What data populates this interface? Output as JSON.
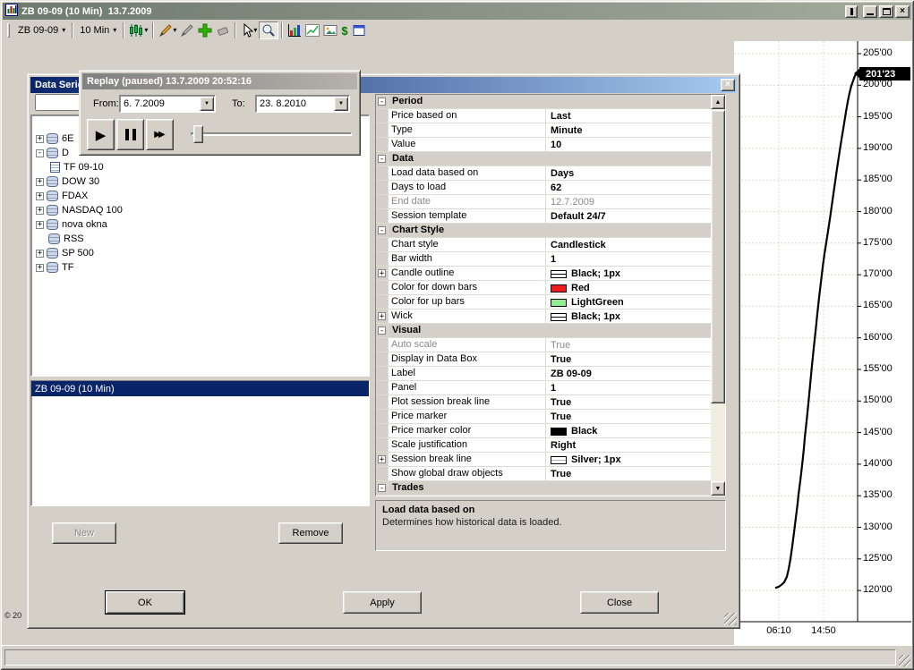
{
  "window": {
    "title": "ZB 09-09 (10 Min)  13.7.2009",
    "copyright": "© 20"
  },
  "toolbar": {
    "instrument": "ZB 09-09",
    "interval": "10 Min"
  },
  "chart": {
    "price_marker": "201'23",
    "price_marker_value": 201.72,
    "y_axis_labels": [
      "205'00",
      "200'00",
      "195'00",
      "190'00",
      "185'00",
      "180'00",
      "175'00",
      "170'00",
      "165'00",
      "160'00",
      "155'00",
      "150'00",
      "145'00",
      "140'00",
      "135'00",
      "130'00",
      "125'00",
      "120'00"
    ],
    "x_axis_labels": [
      "06:10",
      "14:50"
    ],
    "curve": [
      [
        864,
        120.4
      ],
      [
        868,
        120.6
      ],
      [
        871,
        120.9
      ],
      [
        874,
        121.3
      ],
      [
        877,
        122.2
      ],
      [
        879,
        123.4
      ],
      [
        881,
        125.0
      ],
      [
        883,
        127.0
      ],
      [
        885,
        129.2
      ],
      [
        887,
        131.5
      ],
      [
        889,
        133.8
      ],
      [
        890,
        135.2
      ],
      [
        892,
        137.4
      ],
      [
        894,
        139.8
      ],
      [
        896,
        142.5
      ],
      [
        897,
        144.2
      ],
      [
        899,
        146.8
      ],
      [
        901,
        149.6
      ],
      [
        903,
        152.6
      ],
      [
        905,
        155.6
      ],
      [
        907,
        158.4
      ],
      [
        909,
        161.0
      ],
      [
        911,
        163.8
      ],
      [
        913,
        166.4
      ],
      [
        915,
        168.8
      ],
      [
        917,
        171.2
      ],
      [
        919,
        173.3
      ],
      [
        922,
        176.0
      ],
      [
        925,
        178.8
      ],
      [
        928,
        181.8
      ],
      [
        931,
        184.8
      ],
      [
        933,
        186.8
      ],
      [
        936,
        189.6
      ],
      [
        938,
        191.4
      ],
      [
        941,
        194.0
      ],
      [
        943,
        195.8
      ],
      [
        945,
        197.4
      ],
      [
        947,
        198.8
      ],
      [
        949,
        199.9
      ],
      [
        951,
        200.7
      ],
      [
        952,
        201.1
      ],
      [
        953,
        201.5
      ],
      [
        954,
        201.72
      ]
    ]
  },
  "replay": {
    "title": "Replay (paused) 13.7.2009 20:52:16",
    "from_label": "From:",
    "from_value": "6. 7.2009",
    "to_label": "To:",
    "to_value": "23. 8.2010"
  },
  "dialog": {
    "title": "Data Series",
    "selected_series": "ZB 09-09 (10 Min)",
    "tree": [
      {
        "expand": "+",
        "icon": "database-icon",
        "label": "6E"
      },
      {
        "expand": "-",
        "icon": "database-icon",
        "label": "D"
      },
      {
        "child": true,
        "icon": "series-icon",
        "label": "TF 09-10"
      },
      {
        "expand": "+",
        "icon": "database-icon",
        "label": "DOW 30"
      },
      {
        "expand": "+",
        "icon": "database-icon",
        "label": "FDAX"
      },
      {
        "expand": "+",
        "icon": "database-icon",
        "label": "NASDAQ 100"
      },
      {
        "expand": "+",
        "icon": "database-icon",
        "label": "nova okna"
      },
      {
        "icon": "database-icon",
        "label": "RSS"
      },
      {
        "expand": "+",
        "icon": "database-icon",
        "label": "SP 500"
      },
      {
        "expand": "+",
        "icon": "database-icon",
        "label": "TF"
      }
    ],
    "properties": [
      {
        "type": "section",
        "label": "Period"
      },
      {
        "type": "row",
        "label": "Price based on",
        "value": "Last"
      },
      {
        "type": "row",
        "label": "Type",
        "value": "Minute"
      },
      {
        "type": "row",
        "label": "Value",
        "value": "10"
      },
      {
        "type": "section",
        "label": "Data"
      },
      {
        "type": "row",
        "label": "Load data based on",
        "value": "Days"
      },
      {
        "type": "row",
        "label": "Days to load",
        "value": "62"
      },
      {
        "type": "row",
        "label": "End date",
        "value": "12.7.2009",
        "disabled": true
      },
      {
        "type": "row",
        "label": "Session template",
        "value": "Default 24/7"
      },
      {
        "type": "section",
        "label": "Chart Style"
      },
      {
        "type": "row",
        "label": "Chart style",
        "value": "Candlestick"
      },
      {
        "type": "row",
        "label": "Bar width",
        "value": "1"
      },
      {
        "type": "row",
        "label": "Candle outline",
        "value": "Black; 1px",
        "expand": "+",
        "swatch_line": "#000000"
      },
      {
        "type": "row",
        "label": "Color for down bars",
        "value": "Red",
        "swatch": "#ee1c1c"
      },
      {
        "type": "row",
        "label": "Color for up bars",
        "value": "LightGreen",
        "swatch": "#90ee90"
      },
      {
        "type": "row",
        "label": "Wick",
        "value": "Black; 1px",
        "expand": "+",
        "swatch_line": "#000000"
      },
      {
        "type": "section",
        "label": "Visual"
      },
      {
        "type": "row",
        "label": "Auto scale",
        "value": "True",
        "disabled": true
      },
      {
        "type": "row",
        "label": "Display in Data Box",
        "value": "True"
      },
      {
        "type": "row",
        "label": "Label",
        "value": "ZB 09-09"
      },
      {
        "type": "row",
        "label": "Panel",
        "value": "1"
      },
      {
        "type": "row",
        "label": "Plot session break line",
        "value": "True"
      },
      {
        "type": "row",
        "label": "Price marker",
        "value": "True"
      },
      {
        "type": "row",
        "label": "Price marker color",
        "value": "Black",
        "swatch": "#000000"
      },
      {
        "type": "row",
        "label": "Scale justification",
        "value": "Right"
      },
      {
        "type": "row",
        "label": "Session break line",
        "value": "Silver; 1px",
        "expand": "+",
        "swatch_line": "#b4b4b4"
      },
      {
        "type": "row",
        "label": "Show global draw objects",
        "value": "True"
      },
      {
        "type": "section",
        "label": "Trades"
      }
    ],
    "help": {
      "title": "Load data based on",
      "text": "Determines how historical data is loaded."
    },
    "buttons": {
      "new": "New",
      "remove": "Remove",
      "ok": "OK",
      "apply": "Apply",
      "close": "Close"
    }
  },
  "icons": {
    "close": "×",
    "dropdown_arrow": "▾",
    "combo_arrow": "▼",
    "scroll_up": "▲",
    "scroll_down": "▼",
    "play": "▶",
    "fast_forward": "▶▶",
    "expand": "+",
    "collapse": "-",
    "toolbar": [
      "candlestick-chart-icon",
      "pencil-icon",
      "pencil-secondary-icon",
      "add-drawing-icon",
      "eraser-icon",
      "pointer-icon",
      "zoom-icon",
      "bar-chart-icon",
      "line-chart-icon",
      "image-icon",
      "dollar-icon",
      "panel-icon"
    ]
  },
  "colors": {
    "accent_blue": "#0a246a",
    "down_red": "#ee1c1c",
    "up_green": "#90ee90",
    "silver": "#b4b4b4",
    "marker_black": "#000000"
  }
}
